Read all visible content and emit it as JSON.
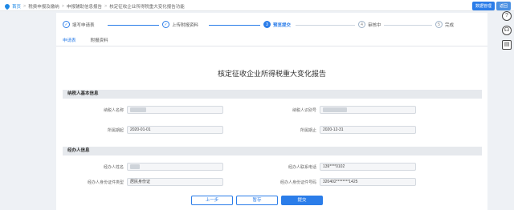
{
  "breadcrumb": {
    "home": "首页",
    "items": [
      "税费申报及缴纳",
      "申报辅助信息报告",
      "核定征收企业所得税重大变化报告功能"
    ]
  },
  "topbar": {
    "btn1": "数据管理",
    "btn2": "返回"
  },
  "steps": [
    {
      "label": "填写申请表",
      "icon": "✓"
    },
    {
      "label": "上传附报资料",
      "icon": "✓"
    },
    {
      "label": "预览提交",
      "icon": "3"
    },
    {
      "label": "审核中",
      "icon": "4"
    },
    {
      "label": "完成",
      "icon": "5"
    }
  ],
  "tabs": [
    "申请表",
    "附报资料"
  ],
  "title": "核定征收企业所得税重大变化报告",
  "section1": {
    "title": "纳税人基本信息",
    "taxpayer_name_label": "纳税人名称",
    "taxpayer_id_label": "纳税人识别号",
    "period_start_label": "所属期起",
    "period_start_value": "2020-01-01",
    "period_end_label": "所属期止",
    "period_end_value": "2020-12-31"
  },
  "section2": {
    "title": "经办人信息",
    "name_label": "经办人姓名",
    "phone_label": "经办人联系电话",
    "phone_value": "139****0102",
    "idtype_label": "经办人身份证件类型",
    "idtype_value": "居民身份证",
    "idno_label": "经办人身份证件号码",
    "idno_value": "320402********1425"
  },
  "buttons": {
    "prev": "上一步",
    "save": "暂存",
    "submit": "提交"
  },
  "colors": {
    "accent": "#2b7de9"
  }
}
